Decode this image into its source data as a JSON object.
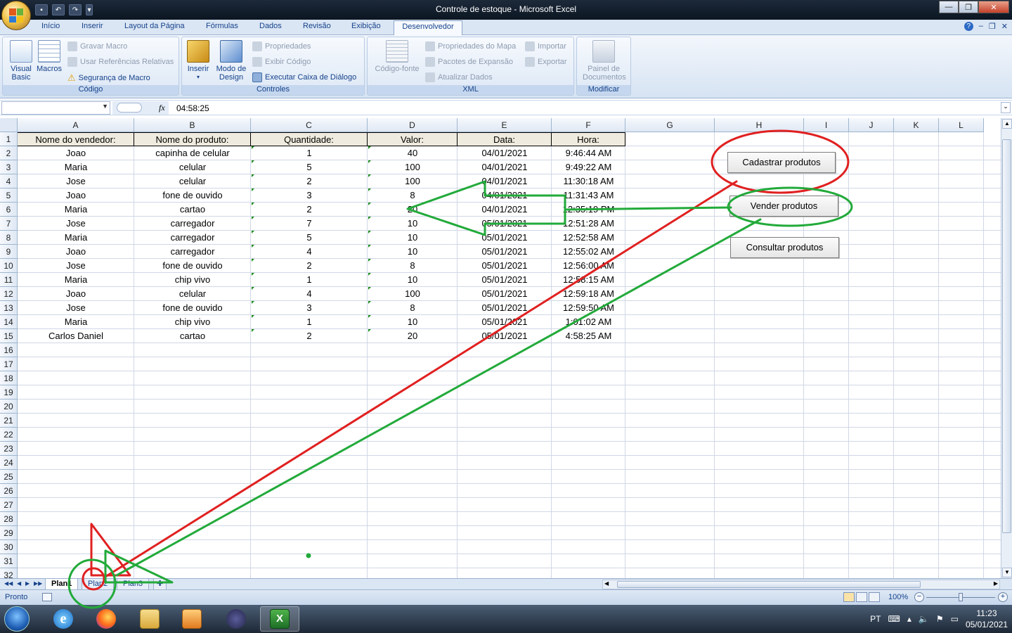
{
  "window": {
    "title": "Controle de estoque - Microsoft Excel",
    "controls": [
      "—",
      "❐",
      "✕"
    ]
  },
  "ribbon": {
    "tabs": [
      "Início",
      "Inserir",
      "Layout da Página",
      "Fórmulas",
      "Dados",
      "Revisão",
      "Exibição",
      "Desenvolvedor"
    ],
    "active_tab": "Desenvolvedor",
    "groups": {
      "codigo": {
        "label": "Código",
        "visual_basic": "Visual Basic",
        "macros": "Macros",
        "gravar_macro": "Gravar Macro",
        "usar_referencias": "Usar Referências Relativas",
        "seguranca_macro": "Segurança de Macro"
      },
      "controles": {
        "label": "Controles",
        "inserir": "Inserir",
        "modo_design": "Modo de Design",
        "propriedades": "Propriedades",
        "exibir_codigo": "Exibir Código",
        "executar_caixa": "Executar Caixa de Diálogo"
      },
      "xml": {
        "label": "XML",
        "codigo_fonte": "Código-fonte",
        "propriedades_mapa": "Propriedades do Mapa",
        "pacotes_expansao": "Pacotes de Expansão",
        "atualizar_dados": "Atualizar Dados",
        "importar": "Importar",
        "exportar": "Exportar"
      },
      "modificar": {
        "label": "Modificar",
        "painel_documentos": "Painel de Documentos"
      }
    }
  },
  "formula_bar": {
    "name_box": "",
    "fx": "fx",
    "value": "04:58:25"
  },
  "sheet": {
    "columns": [
      "A",
      "B",
      "C",
      "D",
      "E",
      "F",
      "G",
      "H",
      "I",
      "J",
      "K",
      "L"
    ],
    "row_numbers": [
      "1",
      "2",
      "3",
      "4",
      "5",
      "6",
      "7",
      "8",
      "9",
      "10",
      "11",
      "12",
      "13",
      "14",
      "15",
      "16",
      "17",
      "18",
      "19",
      "20",
      "21",
      "22",
      "23",
      "24",
      "25",
      "26",
      "27",
      "28",
      "29",
      "30",
      "31",
      "32"
    ],
    "headers": [
      "Nome do vendedor:",
      "Nome do produto:",
      "Quantidade:",
      "Valor:",
      "Data:",
      "Hora:"
    ],
    "rows": [
      [
        "Joao",
        "capinha de celular",
        "1",
        "40",
        "04/01/2021",
        "9:46:44 AM"
      ],
      [
        "Maria",
        "celular",
        "5",
        "100",
        "04/01/2021",
        "9:49:22 AM"
      ],
      [
        "Jose",
        "celular",
        "2",
        "100",
        "04/01/2021",
        "11:30:18 AM"
      ],
      [
        "Joao",
        "fone de ouvido",
        "3",
        "8",
        "04/01/2021",
        "11:31:43 AM"
      ],
      [
        "Maria",
        "cartao",
        "2",
        "20",
        "04/01/2021",
        "12:35:19 PM"
      ],
      [
        "Jose",
        "carregador",
        "7",
        "10",
        "05/01/2021",
        "12:51:28 AM"
      ],
      [
        "Maria",
        "carregador",
        "5",
        "10",
        "05/01/2021",
        "12:52:58 AM"
      ],
      [
        "Joao",
        "carregador",
        "4",
        "10",
        "05/01/2021",
        "12:55:02 AM"
      ],
      [
        "Jose",
        "fone de ouvido",
        "2",
        "8",
        "05/01/2021",
        "12:56:00 AM"
      ],
      [
        "Maria",
        "chip vivo",
        "1",
        "10",
        "05/01/2021",
        "12:58:15 AM"
      ],
      [
        "Joao",
        "celular",
        "4",
        "100",
        "05/01/2021",
        "12:59:18 AM"
      ],
      [
        "Jose",
        "fone de ouvido",
        "3",
        "8",
        "05/01/2021",
        "12:59:50 AM"
      ],
      [
        "Maria",
        "chip vivo",
        "1",
        "10",
        "05/01/2021",
        "1:01:02 AM"
      ],
      [
        "Carlos Daniel",
        "cartao",
        "2",
        "20",
        "05/01/2021",
        "4:58:25 AM"
      ]
    ],
    "buttons": {
      "cadastrar": "Cadastrar produtos",
      "vender": "Vender produtos",
      "consultar": "Consultar produtos"
    },
    "tabs": [
      "Plan1",
      "Plan2",
      "Plan3"
    ],
    "active_tab": "Plan1"
  },
  "status_bar": {
    "status": "Pronto",
    "zoom": "100%"
  },
  "taskbar": {
    "apps": [
      "internet-explorer",
      "firefox",
      "file-explorer",
      "media-player",
      "media-app",
      "excel"
    ],
    "language": "PT",
    "time": "11:23",
    "date": "05/01/2021"
  },
  "colors": {
    "annotation_red": "#e02020",
    "annotation_green": "#22aa3a",
    "ribbon_text": "#15428b",
    "header_fill": "#efebde"
  }
}
